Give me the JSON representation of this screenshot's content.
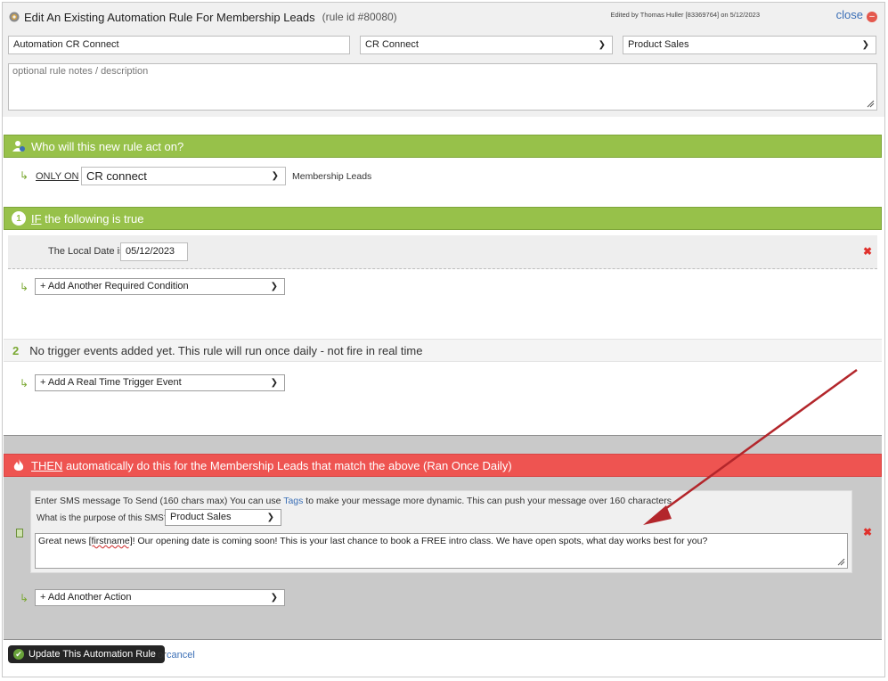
{
  "header": {
    "title": "Edit An Existing Automation Rule For Membership Leads",
    "rule_id": "(rule id #80080)",
    "edited_by": "Edited by Thomas Huller [83369764] on 5/12/2023",
    "close_label": "close"
  },
  "form": {
    "rule_name": "Automation CR Connect",
    "category_select": "CR Connect",
    "department_select": "Product Sales",
    "notes_placeholder": "optional rule notes / description"
  },
  "who_section": {
    "title": "Who will this new rule act on?",
    "only_on_label": "ONLY ON",
    "only_on_value": "CR connect",
    "target_label": "Membership Leads"
  },
  "if_section": {
    "number": "1",
    "title_prefix": "IF",
    "title_rest": " the following is true",
    "condition_label": "The Local Date is",
    "condition_value": "05/12/2023",
    "add_condition": "+ Add Another Required Condition"
  },
  "trigger_section": {
    "number": "2",
    "title": "No trigger events added yet. This rule will run once daily - not fire in real time",
    "add_trigger": "+ Add A Real Time Trigger Event"
  },
  "then_section": {
    "title_prefix": "THEN",
    "title_rest": " automatically do this for the Membership Leads that match the above (Ran Once Daily)",
    "sms_instruction_1": "Enter SMS message To Send (160 chars max) You can use ",
    "sms_tags_link": "Tags",
    "sms_instruction_2": " to make your message more dynamic. This can push your message over 160 characters",
    "purpose_label": "What is the purpose of this SMS?",
    "purpose_value": "Product Sales",
    "sms_text_before": "Great news ",
    "sms_text_token": "[firstname]",
    "sms_text_after": "! Our opening date is coming soon! This is your last chance to book a FREE intro class. We have open spots, what day works best for you?",
    "add_action": "+ Add Another Action"
  },
  "footer": {
    "update_button": "Update This Automation Rule",
    "or_text": "or",
    "cancel_link": "cancel"
  },
  "colors": {
    "green_bar": "#97c14a",
    "red_bar": "#ee5451",
    "link": "#3b6fb6",
    "annotation_arrow": "#b3262b"
  },
  "icons": {
    "title": "gear-icon",
    "who": "user-icon",
    "then": "flame-icon",
    "branch": "branch-arrow-icon",
    "delete": "delete-x-icon",
    "sms": "sms-icon"
  }
}
